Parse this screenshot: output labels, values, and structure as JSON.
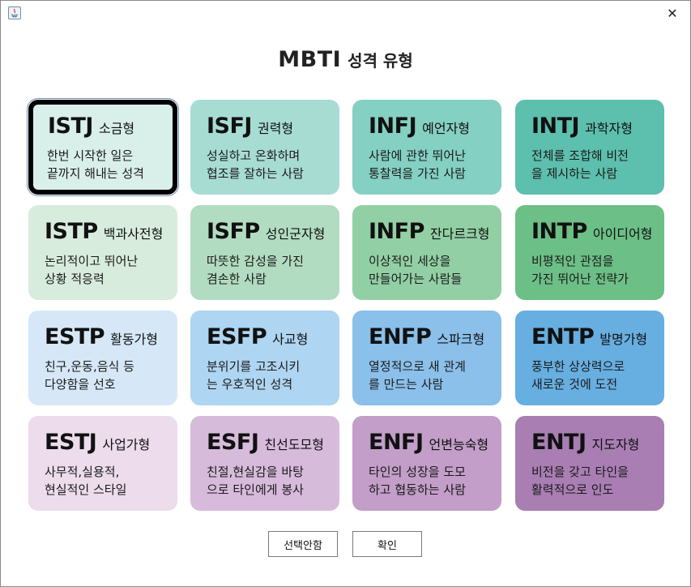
{
  "window": {
    "close_symbol": "✕"
  },
  "header": {
    "title_main": "MBTI",
    "title_sub": "성격 유형"
  },
  "cards": [
    {
      "code": "ISTJ",
      "name": "소금형",
      "line1": "한번 시작한 일은",
      "line2": "끝까지 해내는 성격",
      "color": "#d9efe9",
      "selected": true
    },
    {
      "code": "ISFJ",
      "name": "권력형",
      "line1": "성실하고 온화하며",
      "line2": "협조를 잘하는 사람",
      "color": "#a7dcd3"
    },
    {
      "code": "INFJ",
      "name": "예언자형",
      "line1": "사람에 관한 뛰어난",
      "line2": "통찰력을 가진 사람",
      "color": "#84d0c2"
    },
    {
      "code": "INTJ",
      "name": "과학자형",
      "line1": "전체를 조합해 비전",
      "line2": "을 제시하는 사람",
      "color": "#5dbfad"
    },
    {
      "code": "ISTP",
      "name": "백과사전형",
      "line1": "논리적이고 뛰어난",
      "line2": "상황 적응력",
      "color": "#d8ecde"
    },
    {
      "code": "ISFP",
      "name": "성인군자형",
      "line1": "따뜻한 감성을 가진",
      "line2": "겸손한 사람",
      "color": "#b2dcc1"
    },
    {
      "code": "INFP",
      "name": "잔다르크형",
      "line1": "이상적인 세상을",
      "line2": "만들어가는 사람들",
      "color": "#92cfa5"
    },
    {
      "code": "INTP",
      "name": "아이디어형",
      "line1": "비평적인 관점을",
      "line2": "가진 뛰어난 전략가",
      "color": "#6cbf86"
    },
    {
      "code": "ESTP",
      "name": "활동가형",
      "line1": "친구,운동,음식 등",
      "line2": "다양함을 선호",
      "color": "#d6e8f7"
    },
    {
      "code": "ESFP",
      "name": "사교형",
      "line1": "분위기를 고조시키",
      "line2": "는 우호적인 성격",
      "color": "#aed5f1"
    },
    {
      "code": "ENFP",
      "name": "스파크형",
      "line1": "열정적으로 새 관계",
      "line2": "를 만드는 사람",
      "color": "#8ac0ea"
    },
    {
      "code": "ENTP",
      "name": "발명가형",
      "line1": "풍부한 상상력으로",
      "line2": "새로운 것에 도전",
      "color": "#67aee1"
    },
    {
      "code": "ESTJ",
      "name": "사업가형",
      "line1": "사무적,실용적,",
      "line2": "현실적인 스타일",
      "color": "#ecdcec"
    },
    {
      "code": "ESFJ",
      "name": "친선도모형",
      "line1": "친절,현실감을 바탕",
      "line2": "으로 타인에게 봉사",
      "color": "#d7bbdb"
    },
    {
      "code": "ENFJ",
      "name": "언변능숙형",
      "line1": "타인의 성장을 도모",
      "line2": "하고 협동하는 사람",
      "color": "#c29ec8"
    },
    {
      "code": "ENTJ",
      "name": "지도자형",
      "line1": "비전을 갖고 타인을",
      "line2": "활력적으로 인도",
      "color": "#a97eb3"
    }
  ],
  "buttons": {
    "cancel_label": "선택안함",
    "ok_label": "확인"
  }
}
